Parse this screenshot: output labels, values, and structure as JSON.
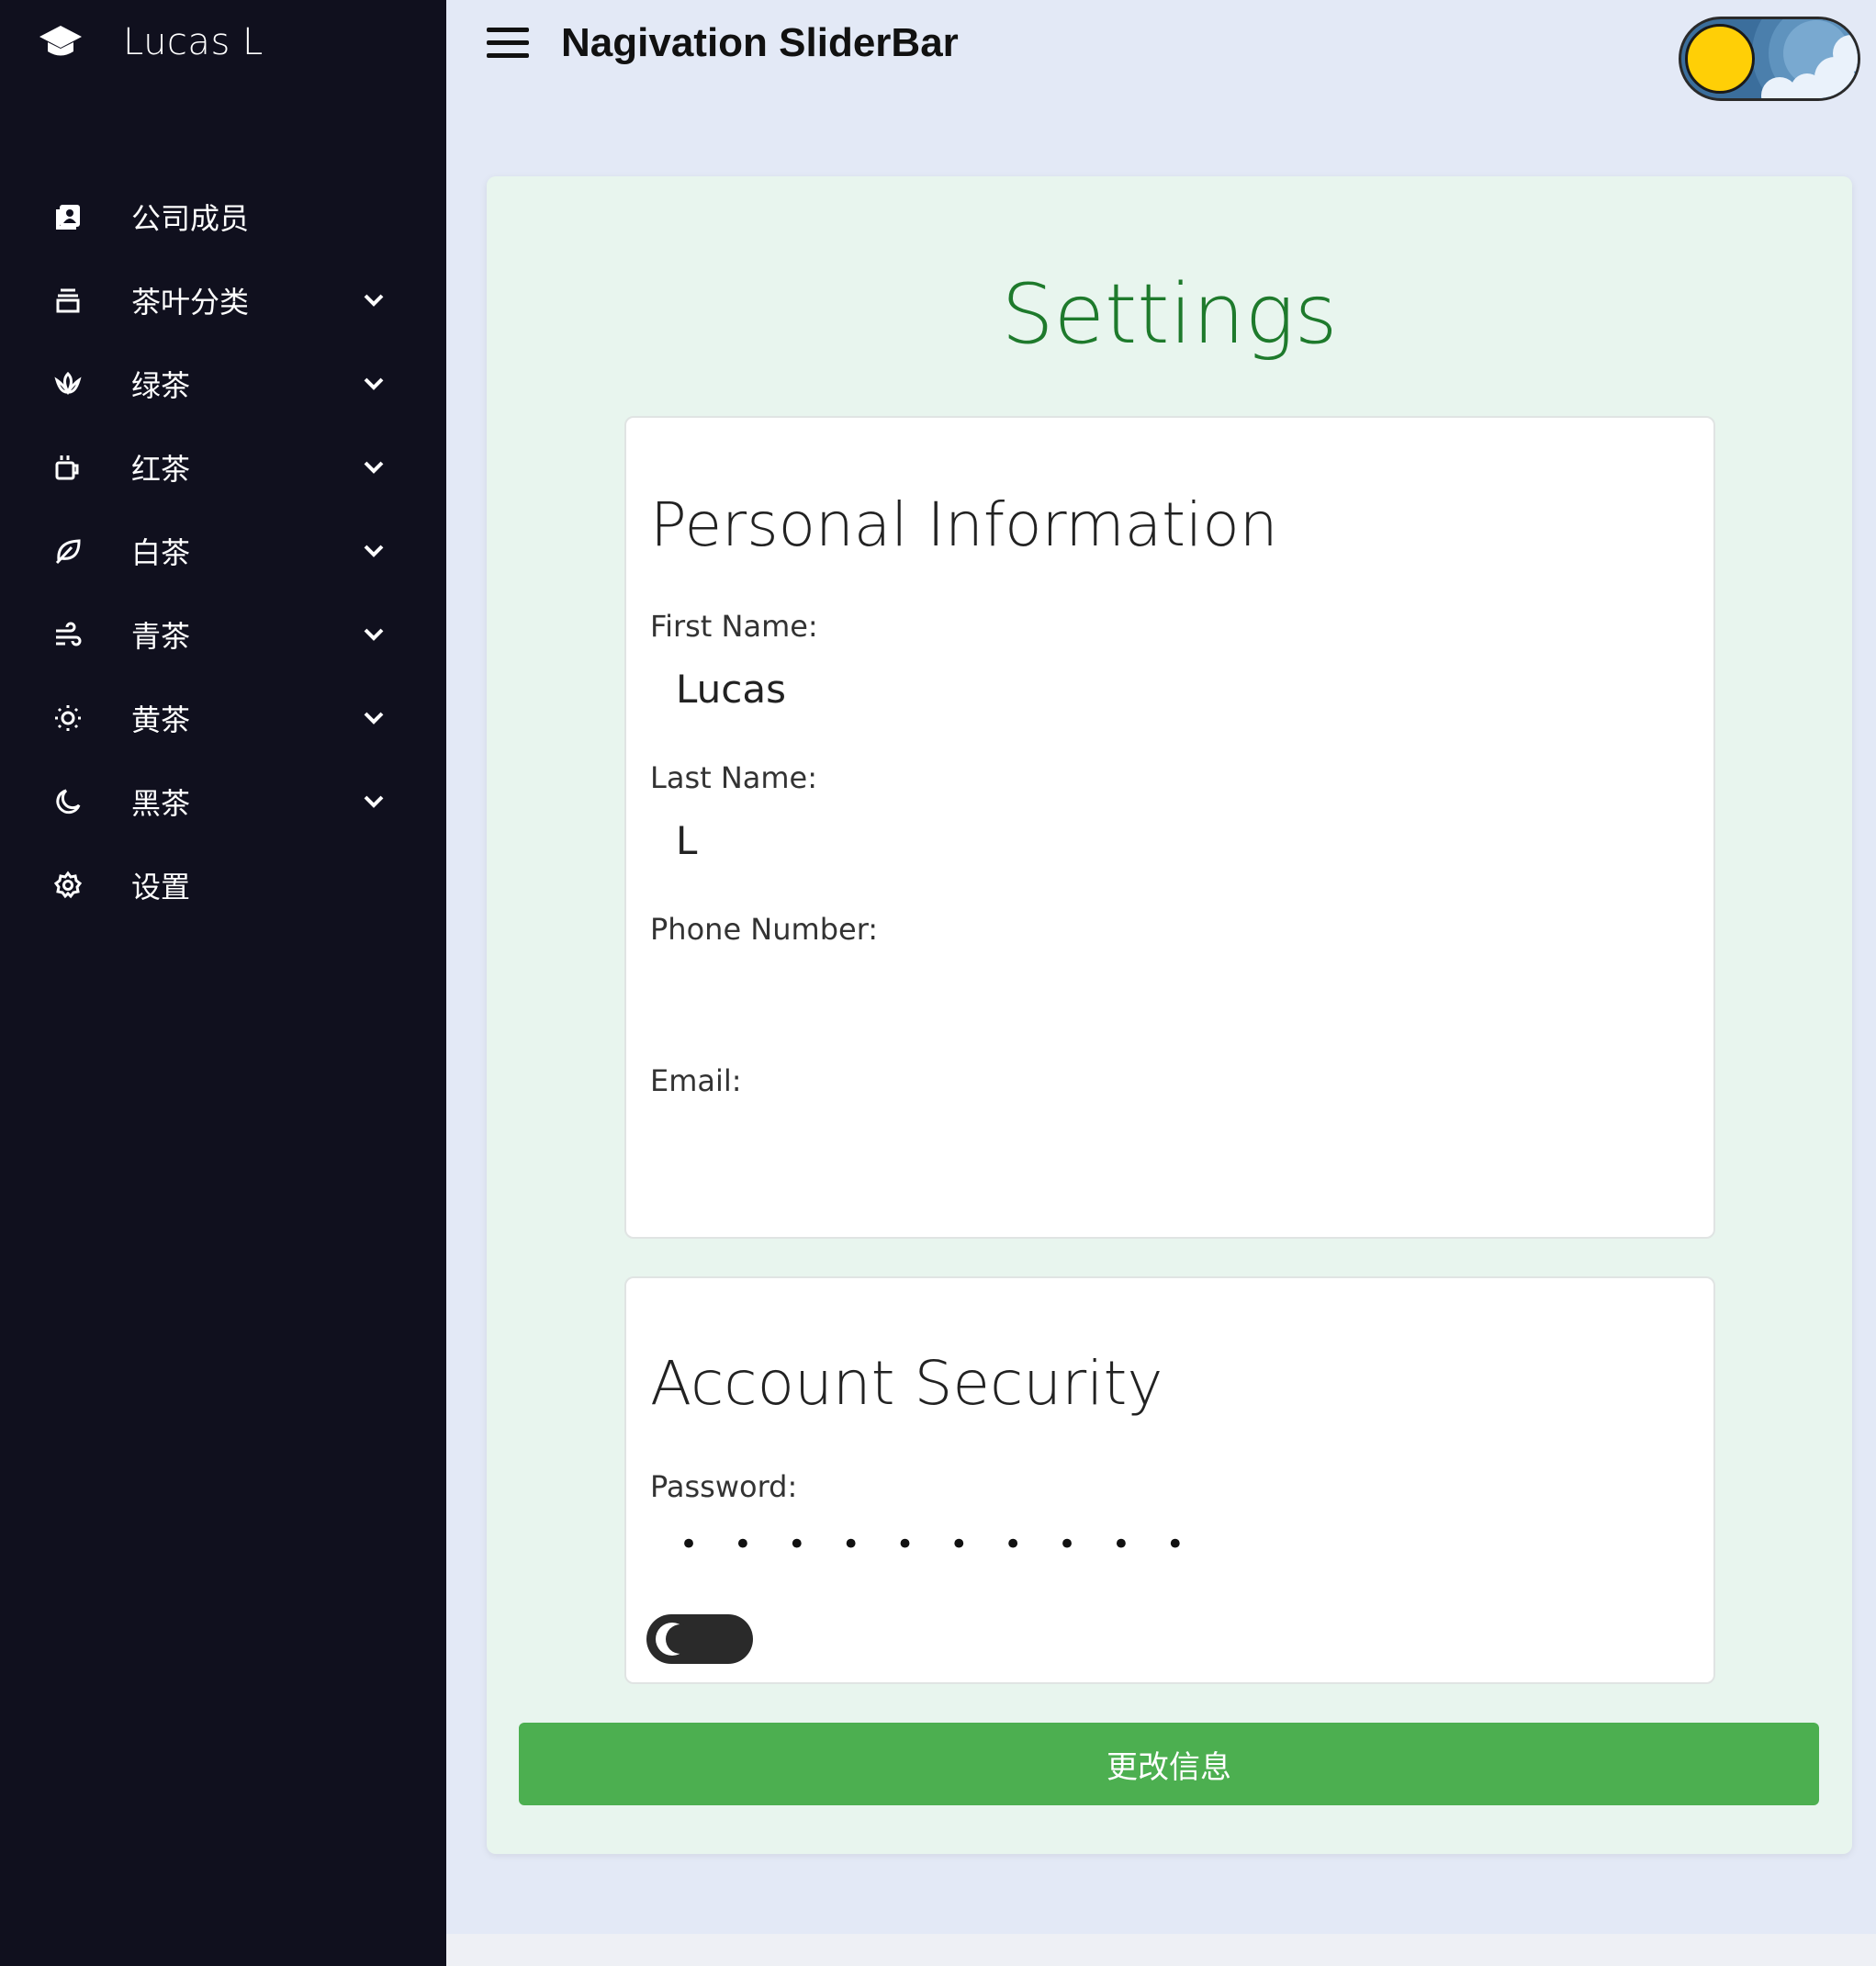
{
  "sidebar": {
    "brand_name": "Lucas L",
    "items": [
      {
        "label": "公司成员",
        "icon": "contacts-book-icon",
        "has_submenu": false
      },
      {
        "label": "茶叶分类",
        "icon": "archive-icon",
        "has_submenu": true
      },
      {
        "label": "绿茶",
        "icon": "lotus-icon",
        "has_submenu": true
      },
      {
        "label": "红茶",
        "icon": "cup-icon",
        "has_submenu": true
      },
      {
        "label": "白茶",
        "icon": "leaf-icon",
        "has_submenu": true
      },
      {
        "label": "青茶",
        "icon": "wind-icon",
        "has_submenu": true
      },
      {
        "label": "黄茶",
        "icon": "sun-icon",
        "has_submenu": true
      },
      {
        "label": "黑茶",
        "icon": "moon-icon",
        "has_submenu": true
      },
      {
        "label": "设置",
        "icon": "gear-icon",
        "has_submenu": false
      }
    ]
  },
  "header": {
    "title": "Nagivation SliderBar"
  },
  "settings": {
    "title": "Settings",
    "personal": {
      "heading": "Personal Information",
      "first_name_label": "First Name:",
      "first_name_value": "Lucas",
      "last_name_label": "Last Name:",
      "last_name_value": "L",
      "phone_label": "Phone Number:",
      "phone_value": "",
      "email_label": "Email:",
      "email_value": ""
    },
    "security": {
      "heading": "Account Security",
      "password_label": "Password:",
      "password_mask": "• • • • • • • • • •"
    },
    "submit_label": "更改信息"
  },
  "colors": {
    "sidebar_bg": "#10101e",
    "page_bg": "#e3e9f6",
    "panel_bg": "#e8f5ee",
    "title_green": "#1e7a2c",
    "button_green": "#4caf50",
    "toggle_sun": "#ffcf06"
  }
}
